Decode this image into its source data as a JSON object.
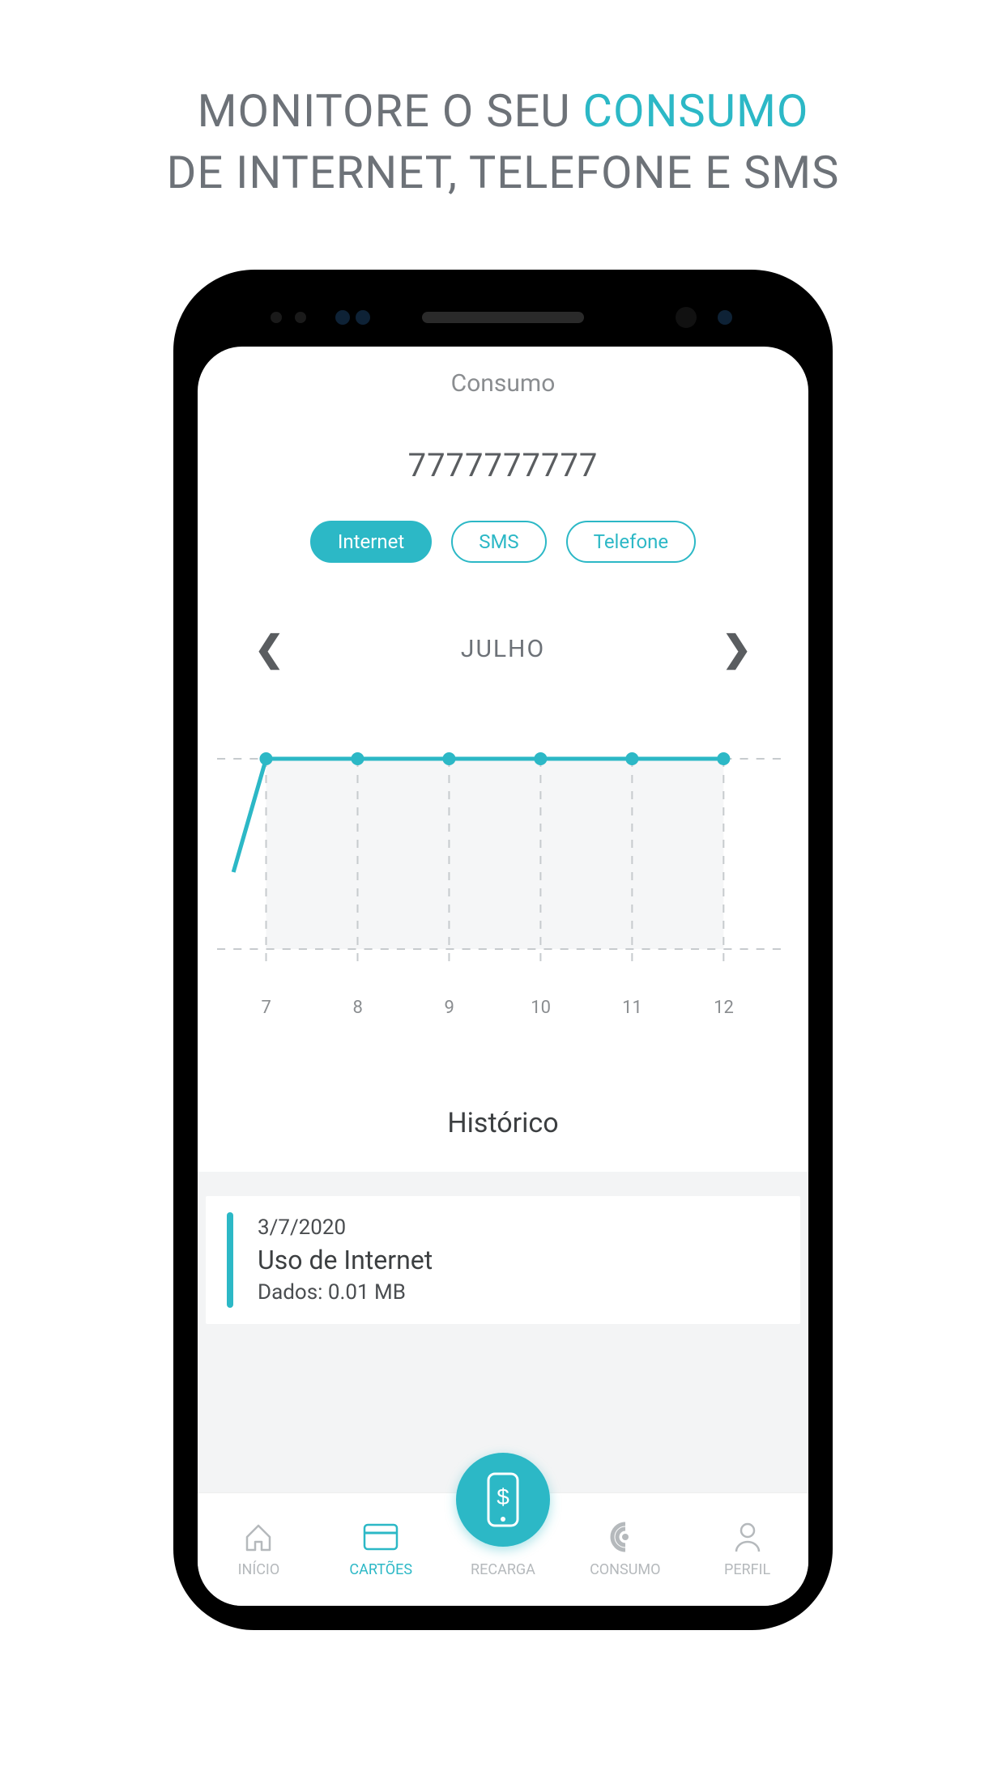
{
  "promo": {
    "line1_pre": "MONITORE O SEU ",
    "line1_accent": "CONSUMO",
    "line2": "DE INTERNET, TELEFONE E SMS"
  },
  "header": {
    "title": "Consumo",
    "phone_number": "7777777777"
  },
  "tabs": {
    "internet": "Internet",
    "sms": "SMS",
    "telefone": "Telefone"
  },
  "month_nav": {
    "label": "JULHO"
  },
  "chart_data": {
    "type": "line",
    "title": "",
    "xlabel": "",
    "ylabel": "",
    "x": [
      7,
      8,
      9,
      10,
      11,
      12
    ],
    "values": [
      0,
      0.01,
      0.01,
      0.01,
      0.01,
      0.01,
      0.01
    ],
    "ylim": [
      0,
      0.01
    ],
    "x_tick_labels": [
      "7",
      "8",
      "9",
      "10",
      "11",
      "12"
    ],
    "accent_color": "#2cb8c6"
  },
  "history": {
    "title": "Histórico",
    "items": [
      {
        "date": "3/7/2020",
        "description": "Uso de Internet",
        "detail": "Dados: 0.01 MB"
      }
    ]
  },
  "nav": {
    "inicio": "INÍCIO",
    "cartoes": "CARTÕES",
    "recarga": "RECARGA",
    "consumo": "CONSUMO",
    "perfil": "PERFIL"
  }
}
